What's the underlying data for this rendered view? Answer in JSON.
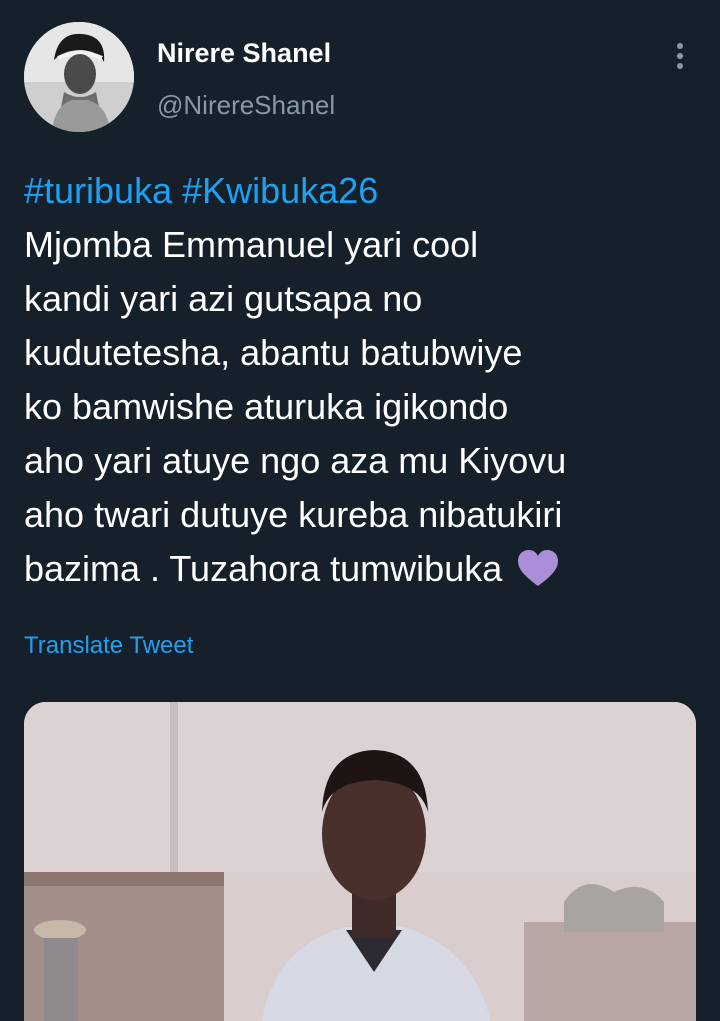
{
  "tweet": {
    "display_name": "Nirere Shanel",
    "handle": "@NirereShanel",
    "hashtags": [
      "#turibuka",
      "#Kwibuka26"
    ],
    "text_lines": [
      "Mjomba Emmanuel yari cool",
      "kandi yari azi gutsapa no",
      "kudutetesha, abantu batubwiye",
      "ko bamwishe aturuka igikondo",
      "aho yari atuye ngo aza mu Kiyovu",
      "aho twari dutuye kureba nibatukiri",
      "bazima . Tuzahora tumwibuka"
    ],
    "emoji": "purple-heart-icon",
    "translate_label": "Translate Tweet"
  },
  "colors": {
    "background": "#15202b",
    "text": "#ffffff",
    "secondary": "#8899a6",
    "link": "#1da1f2",
    "heart": "#ab8ed8"
  }
}
